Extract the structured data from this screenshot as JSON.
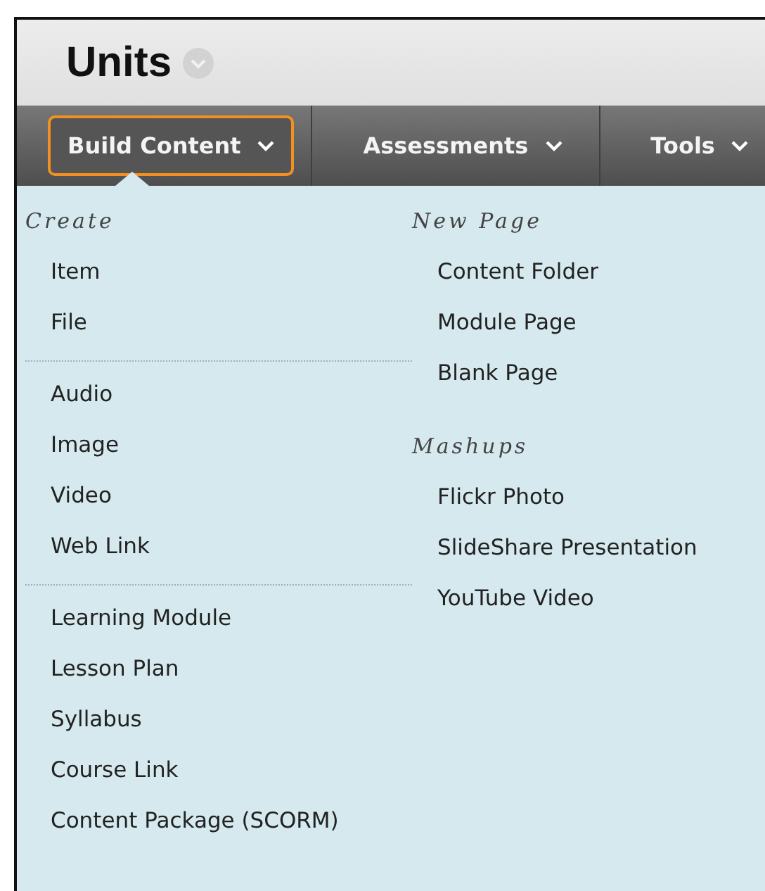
{
  "page_title": "Units",
  "tabs": [
    {
      "label": "Build Content",
      "selected": true
    },
    {
      "label": "Assessments",
      "selected": false
    },
    {
      "label": "Tools",
      "selected": false
    }
  ],
  "menu": {
    "columns": [
      {
        "sections": [
          {
            "heading": "Create",
            "groups": [
              [
                "Item",
                "File"
              ],
              [
                "Audio",
                "Image",
                "Video",
                "Web Link"
              ],
              [
                "Learning Module",
                "Lesson Plan",
                "Syllabus",
                "Course Link",
                "Content Package (SCORM)"
              ]
            ]
          }
        ]
      },
      {
        "sections": [
          {
            "heading": "New Page",
            "groups": [
              [
                "Content Folder",
                "Module Page",
                "Blank Page"
              ]
            ]
          },
          {
            "heading": "Mashups",
            "groups": [
              [
                "Flickr Photo",
                "SlideShare Presentation",
                "YouTube Video"
              ]
            ]
          }
        ]
      }
    ]
  }
}
